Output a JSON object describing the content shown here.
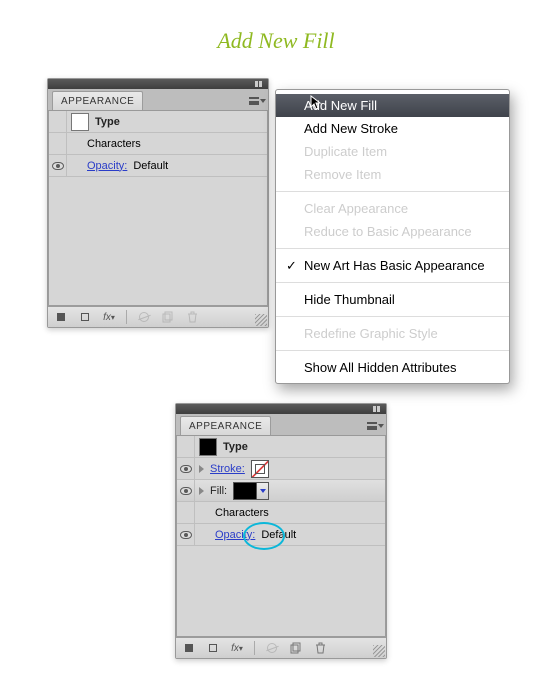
{
  "heading": "Add New Fill",
  "panel1": {
    "tab": "APPEARANCE",
    "type_label": "Type",
    "characters": "Characters",
    "opacity_label": "Opacity:",
    "opacity_value": "Default",
    "footer": {
      "fx": "fx"
    }
  },
  "flyout": {
    "add_fill": "Add New Fill",
    "add_stroke": "Add New Stroke",
    "duplicate": "Duplicate Item",
    "remove": "Remove Item",
    "clear": "Clear Appearance",
    "reduce": "Reduce to Basic Appearance",
    "newart": "New Art Has Basic Appearance",
    "hide_thumb": "Hide Thumbnail",
    "redefine": "Redefine Graphic Style",
    "show_hidden": "Show All Hidden Attributes"
  },
  "panel2": {
    "tab": "APPEARANCE",
    "type_label": "Type",
    "stroke_label": "Stroke:",
    "fill_label": "Fill:",
    "characters": "Characters",
    "opacity_label": "Opacity:",
    "opacity_value": "Default",
    "footer": {
      "fx": "fx"
    }
  }
}
